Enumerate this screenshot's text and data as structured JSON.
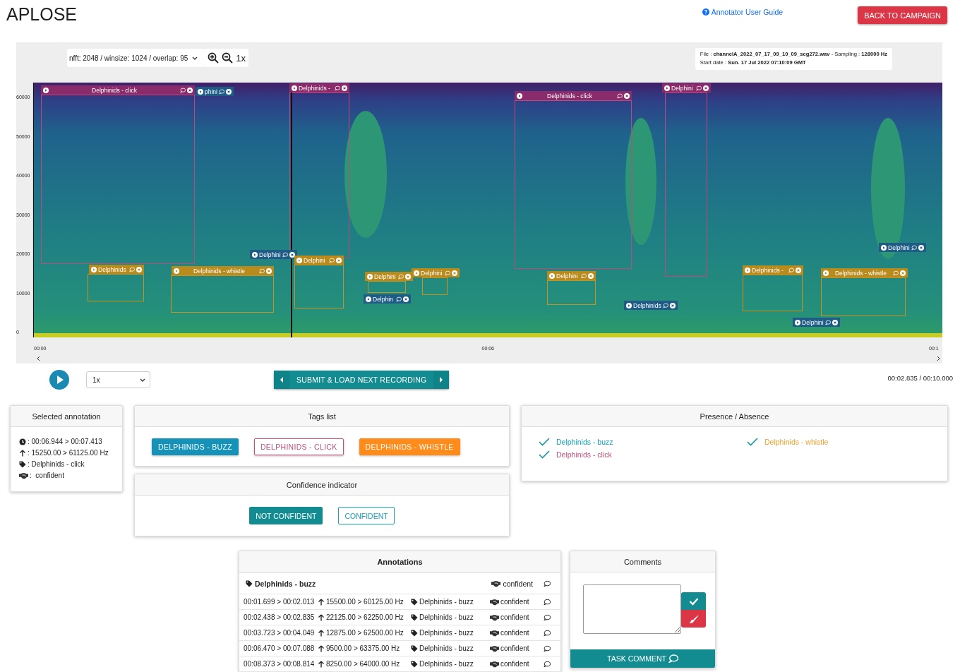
{
  "app": {
    "title": "APLOSE",
    "guide_link": "Annotator User Guide",
    "back_button": "BACK TO CAMPAIGN"
  },
  "toolbar": {
    "fft_select": "nfft: 2048 / winsize: 1024 / overlap: 95",
    "zoom_level": "1x",
    "file_info": "File : **channelA_2022_07_17_09_10_09_seg272.wav** - Sampling : **128000 Hz**",
    "start_date": "Start date : **Sun. 17 Jul 2022 07:10:09 GMT**"
  },
  "spectrogram": {
    "y_ticks": [
      "60000",
      "50000",
      "40000",
      "30000",
      "20000",
      "10000",
      "0"
    ],
    "x_ticks": [
      "00:00",
      "00:06",
      "00:1"
    ],
    "annotations": [
      {
        "label": "Delphinids - click",
        "kind": "click"
      },
      {
        "label": "phini",
        "kind": "buzz"
      },
      {
        "label": "Delphinids -",
        "kind": "click"
      },
      {
        "label": "Delphinids",
        "kind": "whistle"
      },
      {
        "label": "Delphinids - whistle",
        "kind": "whistle"
      },
      {
        "label": "Delphini",
        "kind": "buzz"
      },
      {
        "label": "Delphini",
        "kind": "whistle"
      },
      {
        "label": "Delphini",
        "kind": "whistle"
      },
      {
        "label": "Delphin",
        "kind": "buzz"
      },
      {
        "label": "Delphini",
        "kind": "whistle"
      },
      {
        "label": "Delphinids - click",
        "kind": "click"
      },
      {
        "label": "Delphini",
        "kind": "click"
      },
      {
        "label": "Delphini",
        "kind": "whistle"
      },
      {
        "label": "Delphinids",
        "kind": "buzz"
      },
      {
        "label": "Delphinids -",
        "kind": "whistle"
      },
      {
        "label": "Delphini",
        "kind": "buzz"
      },
      {
        "label": "Delphinids - whistle",
        "kind": "whistle"
      },
      {
        "label": "Delphini",
        "kind": "buzz"
      }
    ]
  },
  "player": {
    "speed": "1x",
    "submit_button": "SUBMIT & LOAD NEXT RECORDING",
    "time": "00:02.835 / 00:10.000"
  },
  "selected_annotation": {
    "title": "Selected annotation",
    "time": ": 00:06.944 > 00:07.413",
    "frequency": ": 15250.00 > 61125.00 Hz",
    "tag": ": Delphinids - click",
    "confidence": ":  confident"
  },
  "tags_list": {
    "title": "Tags list",
    "tags": [
      {
        "label": "DELPHINIDS - BUZZ",
        "kind": "buzz",
        "selected": false
      },
      {
        "label": "DELPHINIDS - CLICK",
        "kind": "click",
        "selected": true
      },
      {
        "label": "DELPHINIDS - WHISTLE",
        "kind": "whistle",
        "selected": false
      }
    ]
  },
  "confidence": {
    "title": "Confidence indicator",
    "options": [
      {
        "label": "NOT CONFIDENT",
        "selected": false
      },
      {
        "label": "CONFIDENT",
        "selected": true
      }
    ]
  },
  "presence": {
    "title": "Presence / Absence",
    "items": [
      {
        "label": "Delphinids - buzz",
        "kind": "buzz",
        "checked": true
      },
      {
        "label": "Delphinids - click",
        "kind": "click",
        "checked": true
      },
      {
        "label": "Delphinids - whistle",
        "kind": "whistle",
        "checked": true
      }
    ]
  },
  "annotations": {
    "title": "Annotations",
    "group": {
      "tag": "Delphinids - buzz",
      "confidence": "confident"
    },
    "rows": [
      {
        "time": "00:01.699 > 00:02.013",
        "frequency": "15500.00 > 60125.00 Hz",
        "tag": "Delphinids - buzz",
        "confidence": "confident"
      },
      {
        "time": "00:02.438 > 00:02.835",
        "frequency": "22125.00 > 62250.00 Hz",
        "tag": "Delphinids - buzz",
        "confidence": "confident"
      },
      {
        "time": "00:03.723 > 00:04.049",
        "frequency": "12875.00 > 62500.00 Hz",
        "tag": "Delphinids - buzz",
        "confidence": "confident"
      },
      {
        "time": "00:06.470 > 00:07.088",
        "frequency": "9500.00 > 63375.00 Hz",
        "tag": "Delphinids - buzz",
        "confidence": "confident"
      },
      {
        "time": "00:08.373 > 00:08.814",
        "frequency": "8250.00 > 64000.00 Hz",
        "tag": "Delphinids - buzz",
        "confidence": "confident"
      }
    ]
  },
  "comments": {
    "title": "Comments",
    "task_comment_button": "TASK COMMENT"
  }
}
